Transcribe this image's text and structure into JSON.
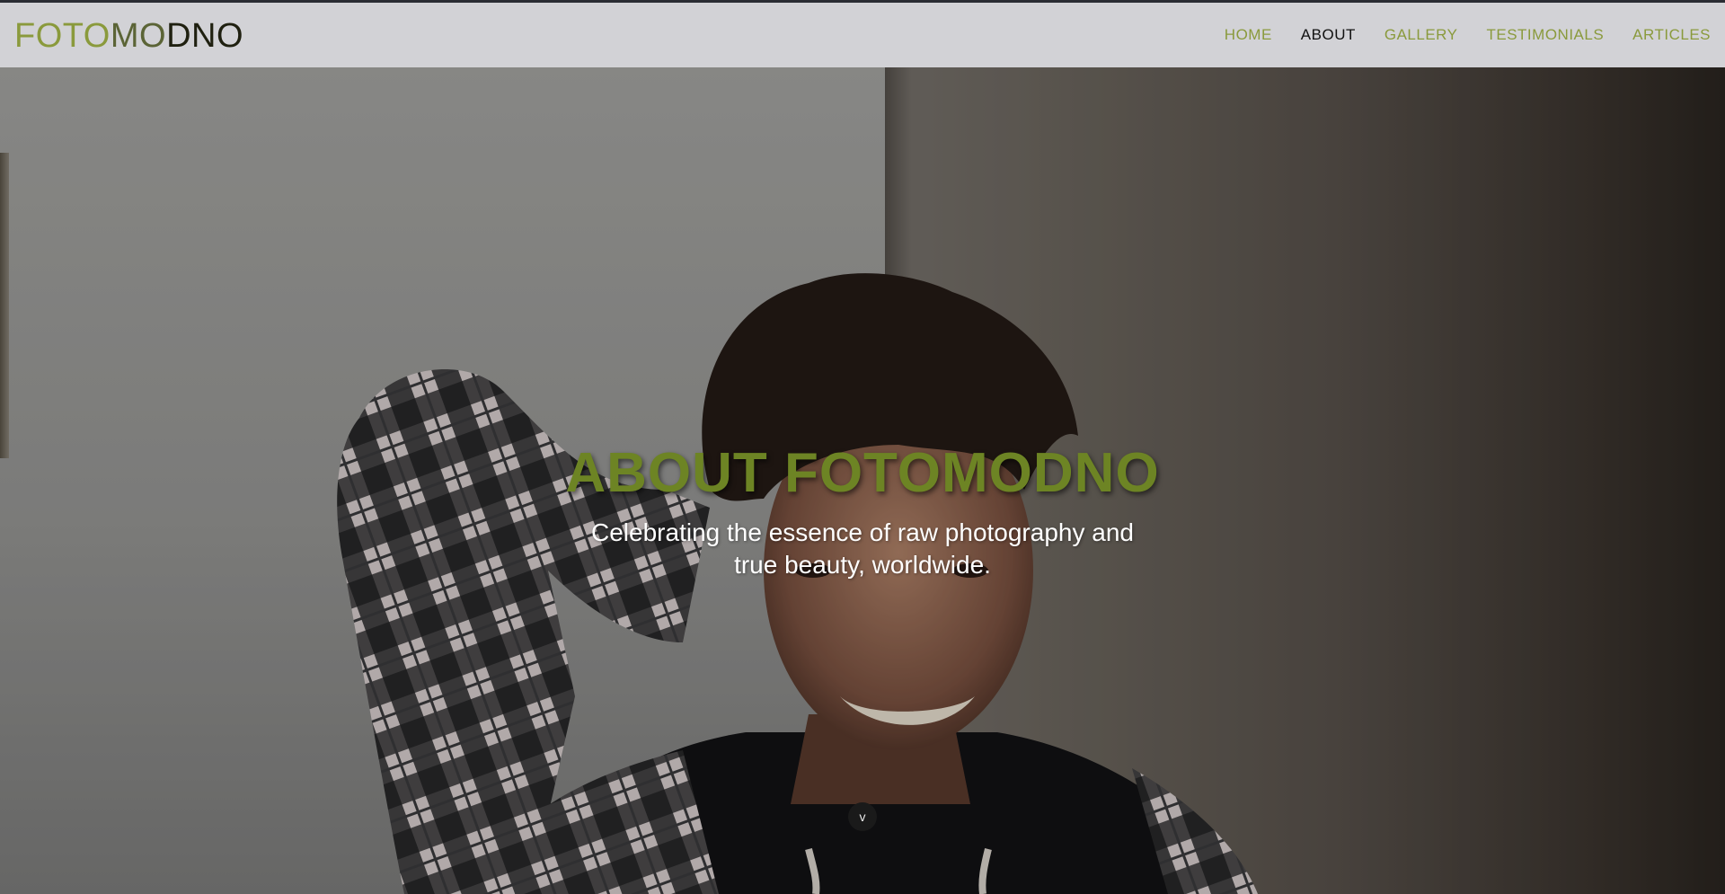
{
  "brand": {
    "logo_part1": "FOTO",
    "logo_part2": "MO",
    "logo_part3": "DNO",
    "colors": {
      "accent": "#8a9a3c",
      "title": "#6d8424",
      "header_bg": "#d2d2d6"
    }
  },
  "nav": {
    "items": [
      {
        "label": "HOME",
        "active": false
      },
      {
        "label": "ABOUT",
        "active": true
      },
      {
        "label": "GALLERY",
        "active": false
      },
      {
        "label": "TESTIMONIALS",
        "active": false
      },
      {
        "label": "ARTICLES",
        "active": false
      }
    ]
  },
  "hero": {
    "title": "ABOUT FOTOMODNO",
    "subtitle": "Celebrating the essence of raw photography and true beauty, worldwide.",
    "scroll_icon": "chevron-down-icon",
    "scroll_glyph": "v"
  }
}
